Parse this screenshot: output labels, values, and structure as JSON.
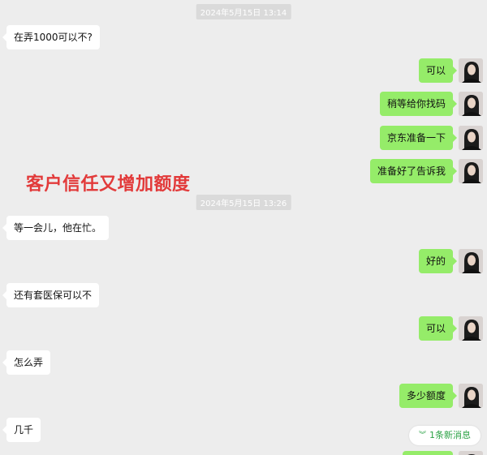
{
  "chat": {
    "timestamps": [
      "2024年5月15日 13:14",
      "2024年5月15日 13:26"
    ],
    "overlay_caption": "客户信任又增加额度",
    "messages": [
      {
        "side": "left",
        "text": "在弄1000可以不?"
      },
      {
        "side": "right",
        "text": "可以"
      },
      {
        "side": "right",
        "text": "稍等给你找码"
      },
      {
        "side": "right",
        "text": "京东准备一下"
      },
      {
        "side": "right",
        "text": "准备好了告诉我"
      },
      {
        "side": "left",
        "text": "等一会儿，他在忙。"
      },
      {
        "side": "right",
        "text": "好的"
      },
      {
        "side": "left",
        "text": "还有套医保可以不"
      },
      {
        "side": "right",
        "text": "可以"
      },
      {
        "side": "left",
        "text": "怎么弄"
      },
      {
        "side": "right",
        "text": "多少额度"
      },
      {
        "side": "left",
        "text": "几千"
      }
    ],
    "new_message_indicator": {
      "icon": "double-chevron-down-icon",
      "label": "1条新消息"
    },
    "colors": {
      "background": "#ededed",
      "incoming_bubble": "#ffffff",
      "outgoing_bubble": "#95ec69",
      "overlay_text": "#e23a3a",
      "indicator_text": "#2ba245"
    }
  }
}
